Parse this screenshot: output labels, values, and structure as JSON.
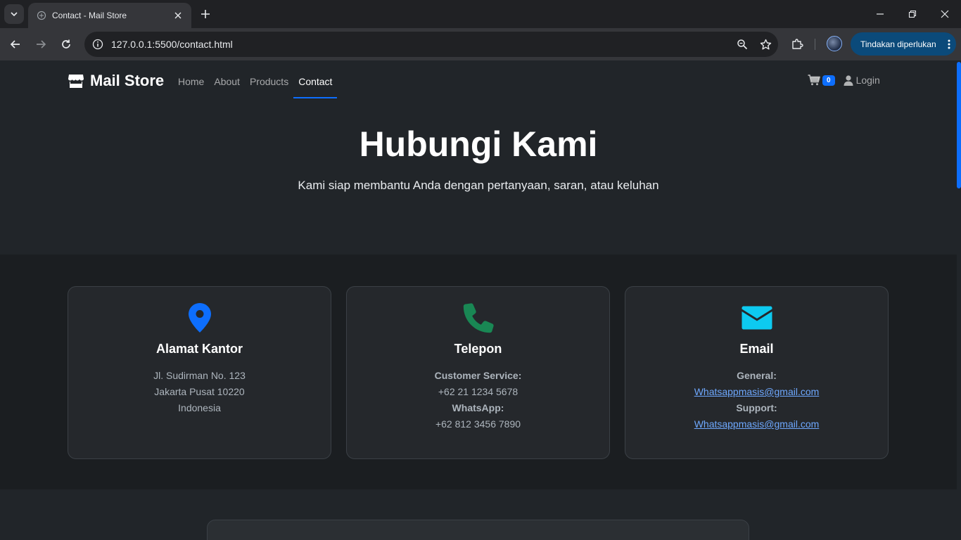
{
  "browser": {
    "tab_title": "Contact - Mail Store",
    "url": "127.0.0.1:5500/contact.html",
    "action_button": "Tindakan diperlukan"
  },
  "site": {
    "brand": "Mail Store",
    "nav": [
      "Home",
      "About",
      "Products",
      "Contact"
    ],
    "active_nav": "Contact",
    "cart_count": "0",
    "login_label": "Login"
  },
  "hero": {
    "title": "Hubungi Kami",
    "subtitle": "Kami siap membantu Anda dengan pertanyaan, saran, atau keluhan"
  },
  "cards": {
    "address": {
      "icon": "map-pin-icon",
      "title": "Alamat Kantor",
      "line1": "Jl. Sudirman No. 123",
      "line2": "Jakarta Pusat 10220",
      "line3": "Indonesia"
    },
    "phone": {
      "icon": "phone-icon",
      "title": "Telepon",
      "cs_label": "Customer Service:",
      "cs_value": "+62 21 1234 5678",
      "wa_label": "WhatsApp:",
      "wa_value": "+62 812 3456 7890"
    },
    "email": {
      "icon": "envelope-icon",
      "title": "Email",
      "general_label": "General:",
      "general_value": "Whatsappmasis@gmail.com",
      "support_label": "Support:",
      "support_value": "Whatsappmasis@gmail.com"
    }
  },
  "colors": {
    "primary": "#0d6efd",
    "success": "#198754",
    "info": "#0dcaf0",
    "page_bg": "#212529"
  }
}
